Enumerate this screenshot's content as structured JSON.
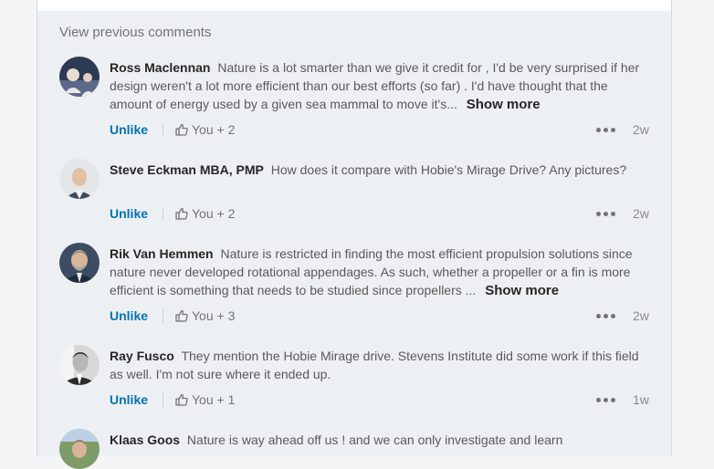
{
  "panel": {
    "view_previous": "View previous comments"
  },
  "comments": [
    {
      "author": "Ross Maclennan",
      "text": "Nature is a lot smarter than we give it credit for , I'd be very surprised if her design weren't a lot more efficient than our best efforts (so far) . I'd have thought that the amount of energy used by a given sea mammal to move it's...",
      "show_more": "Show more",
      "unlike": "Unlike",
      "likes": "You + 2",
      "age": "2w"
    },
    {
      "author": "Steve Eckman MBA, PMP",
      "text": "How does it compare with Hobie's Mirage Drive? Any pictures?",
      "unlike": "Unlike",
      "likes": "You + 2",
      "age": "2w"
    },
    {
      "author": "Rik Van Hemmen",
      "text": "Nature is restricted in finding the most efficient propulsion solutions since nature never developed rotational appendages. As such, whether a propeller or a fin is more efficient is something that needs to be studied since propellers ...",
      "show_more": "Show more",
      "unlike": "Unlike",
      "likes": "You + 3",
      "age": "2w"
    },
    {
      "author": "Ray Fusco",
      "text": "They mention the Hobie Mirage drive. Stevens Institute did some work if this field as well. I'm not sure where it ended up.",
      "unlike": "Unlike",
      "likes": "You + 1",
      "age": "1w"
    },
    {
      "author": "Klaas Goos",
      "text": "Nature is way ahead off us ! and we can only investigate and learn"
    }
  ],
  "icons": {
    "like": "thumbs-up-icon",
    "more": "more-options-icon"
  },
  "colors": {
    "link": "#0073b1",
    "panel_bg": "#edf0f3"
  }
}
